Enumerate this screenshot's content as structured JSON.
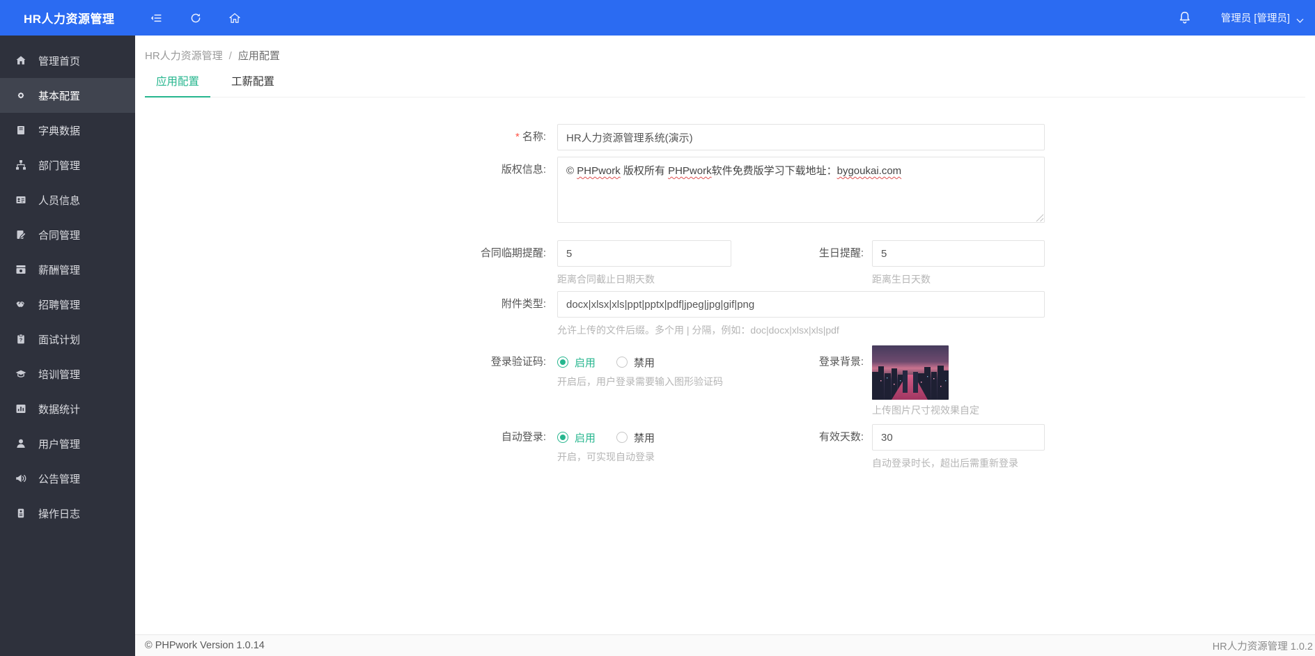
{
  "colors": {
    "header_bg": "#2b6bf2",
    "sidebar_bg": "#2e313c",
    "sidebar_active_bg": "#40444f",
    "accent_green": "#26b68e",
    "required_red": "#ff5244",
    "hint_gray": "#b5b5b5"
  },
  "header": {
    "title": "HR人力资源管理",
    "user_label": "管理员 [管理员]",
    "icons": [
      "collapse-menu-icon",
      "refresh-icon",
      "home-icon",
      "bell-icon",
      "chevron-down-icon"
    ]
  },
  "sidebar": {
    "items": [
      {
        "label": "管理首页",
        "icon": "home-icon",
        "active": false
      },
      {
        "label": "基本配置",
        "icon": "gear-icon",
        "active": true
      },
      {
        "label": "字典数据",
        "icon": "book-icon",
        "active": false
      },
      {
        "label": "部门管理",
        "icon": "sitemap-icon",
        "active": false
      },
      {
        "label": "人员信息",
        "icon": "idcard-icon",
        "active": false
      },
      {
        "label": "合同管理",
        "icon": "contract-pen-icon",
        "active": false
      },
      {
        "label": "薪酬管理",
        "icon": "money-icon",
        "active": false
      },
      {
        "label": "招聘管理",
        "icon": "handshake-icon",
        "active": false
      },
      {
        "label": "面试计划",
        "icon": "clipboard-question-icon",
        "active": false
      },
      {
        "label": "培训管理",
        "icon": "graduation-cap-icon",
        "active": false
      },
      {
        "label": "数据统计",
        "icon": "bar-chart-icon",
        "active": false
      },
      {
        "label": "用户管理",
        "icon": "user-icon",
        "active": false
      },
      {
        "label": "公告管理",
        "icon": "megaphone-icon",
        "active": false
      },
      {
        "label": "操作日志",
        "icon": "log-badge-icon",
        "active": false
      }
    ]
  },
  "breadcrumb": {
    "root": "HR人力资源管理",
    "separator": "/",
    "current": "应用配置"
  },
  "tabs": {
    "items": [
      {
        "label": "应用配置",
        "active": true
      },
      {
        "label": "工薪配置",
        "active": false
      }
    ]
  },
  "form": {
    "name": {
      "label": "名称:",
      "required_mark": "*",
      "value": "HR人力资源管理系统(演示)"
    },
    "copyright": {
      "label": "版权信息:",
      "segments": [
        {
          "t": "© ",
          "wavy": false
        },
        {
          "t": "PHPwork",
          "wavy": true
        },
        {
          "t": " 版权所有 ",
          "wavy": false
        },
        {
          "t": "PHPwork",
          "wavy": true
        },
        {
          "t": "软件免费版学习下载地址：",
          "wavy": false
        },
        {
          "t": "bygoukai.com",
          "wavy": true
        }
      ]
    },
    "contract_reminder": {
      "label": "合同临期提醒:",
      "value": "5",
      "hint": "距离合同截止日期天数"
    },
    "birthday_reminder": {
      "label": "生日提醒:",
      "value": "5",
      "hint": "距离生日天数"
    },
    "attachment_types": {
      "label": "附件类型:",
      "value": "docx|xlsx|xls|ppt|pptx|pdf|jpeg|jpg|gif|png",
      "hint": "允许上传的文件后缀。多个用 | 分隔，例如：doc|docx|xlsx|xls|pdf"
    },
    "login_captcha": {
      "label": "登录验证码:",
      "options": [
        {
          "label": "启用",
          "checked": true
        },
        {
          "label": "禁用",
          "checked": false
        }
      ],
      "hint": "开启后，用户登录需要输入图形验证码"
    },
    "login_background": {
      "label": "登录背景:",
      "hint": "上传图片尺寸视效果自定",
      "image_desc": "city-skyline-dusk-thumbnail"
    },
    "auto_login": {
      "label": "自动登录:",
      "options": [
        {
          "label": "启用",
          "checked": true
        },
        {
          "label": "禁用",
          "checked": false
        }
      ],
      "hint": "开启，可实现自动登录"
    },
    "valid_days": {
      "label": "有效天数:",
      "value": "30",
      "hint": "自动登录时长，超出后需重新登录"
    }
  },
  "footer": {
    "left": "© PHPwork Version 1.0.14",
    "right": "HR人力资源管理 1.0.2"
  }
}
